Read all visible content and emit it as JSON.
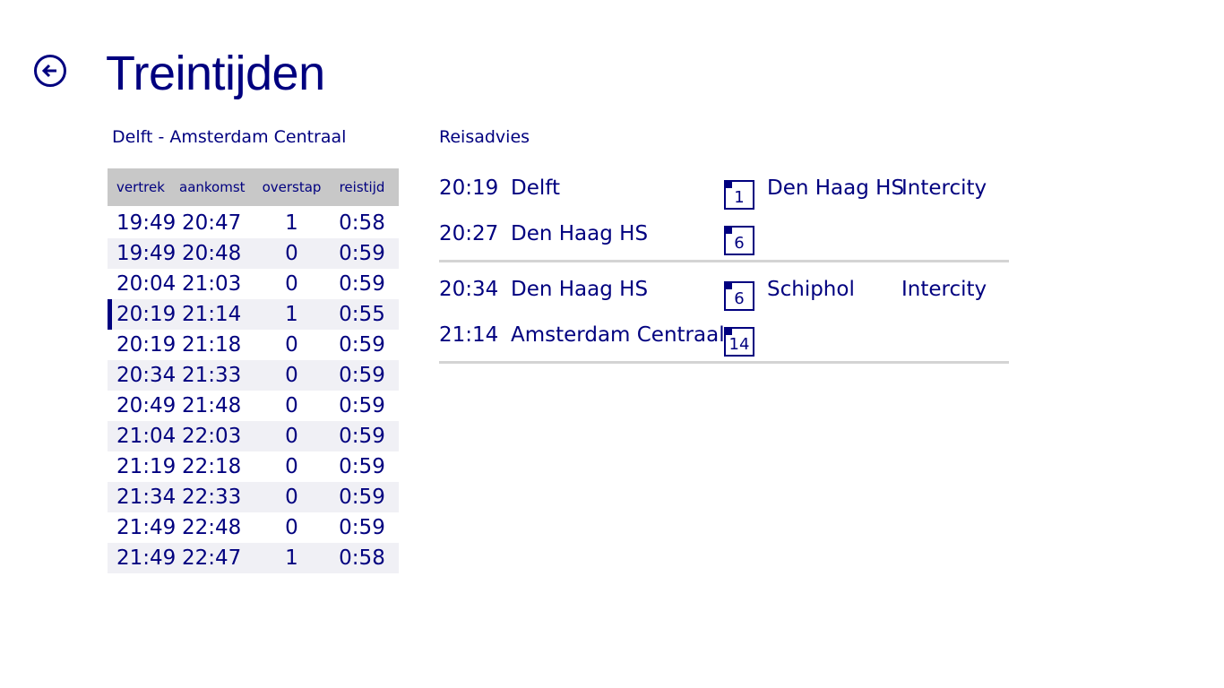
{
  "header": {
    "back_icon": "back-arrow-icon",
    "title": "Treintijden"
  },
  "routes": {
    "label": "Delft - Amsterdam Centraal",
    "columns": [
      "vertrek",
      "aankomst",
      "overstap",
      "reistijd"
    ],
    "rows": [
      {
        "vertrek": "19:49",
        "aankomst": "20:47",
        "overstap": "1",
        "reistijd": "0:58"
      },
      {
        "vertrek": "19:49",
        "aankomst": "20:48",
        "overstap": "0",
        "reistijd": "0:59"
      },
      {
        "vertrek": "20:04",
        "aankomst": "21:03",
        "overstap": "0",
        "reistijd": "0:59"
      },
      {
        "vertrek": "20:19",
        "aankomst": "21:14",
        "overstap": "1",
        "reistijd": "0:55"
      },
      {
        "vertrek": "20:19",
        "aankomst": "21:18",
        "overstap": "0",
        "reistijd": "0:59"
      },
      {
        "vertrek": "20:34",
        "aankomst": "21:33",
        "overstap": "0",
        "reistijd": "0:59"
      },
      {
        "vertrek": "20:49",
        "aankomst": "21:48",
        "overstap": "0",
        "reistijd": "0:59"
      },
      {
        "vertrek": "21:04",
        "aankomst": "22:03",
        "overstap": "0",
        "reistijd": "0:59"
      },
      {
        "vertrek": "21:19",
        "aankomst": "22:18",
        "overstap": "0",
        "reistijd": "0:59"
      },
      {
        "vertrek": "21:34",
        "aankomst": "22:33",
        "overstap": "0",
        "reistijd": "0:59"
      },
      {
        "vertrek": "21:49",
        "aankomst": "22:48",
        "overstap": "0",
        "reistijd": "0:59"
      },
      {
        "vertrek": "21:49",
        "aankomst": "22:47",
        "overstap": "1",
        "reistijd": "0:58"
      }
    ]
  },
  "advice": {
    "label": "Reisadvies",
    "legs": [
      {
        "direction": "Den Haag HS",
        "train_type": "Intercity",
        "departure": {
          "time": "20:19",
          "station": "Delft",
          "platform": "1"
        },
        "arrival": {
          "time": "20:27",
          "station": "Den Haag HS",
          "platform": "6"
        }
      },
      {
        "direction": "Schiphol",
        "train_type": "Intercity",
        "departure": {
          "time": "20:34",
          "station": "Den Haag HS",
          "platform": "6"
        },
        "arrival": {
          "time": "21:14",
          "station": "Amsterdam Centraal",
          "platform": "14"
        }
      }
    ]
  },
  "colors": {
    "accent": "#00007f",
    "header_bg": "#c8c8c8",
    "alt_row_bg": "#f0f0f5",
    "divider": "#d4d4d4"
  }
}
